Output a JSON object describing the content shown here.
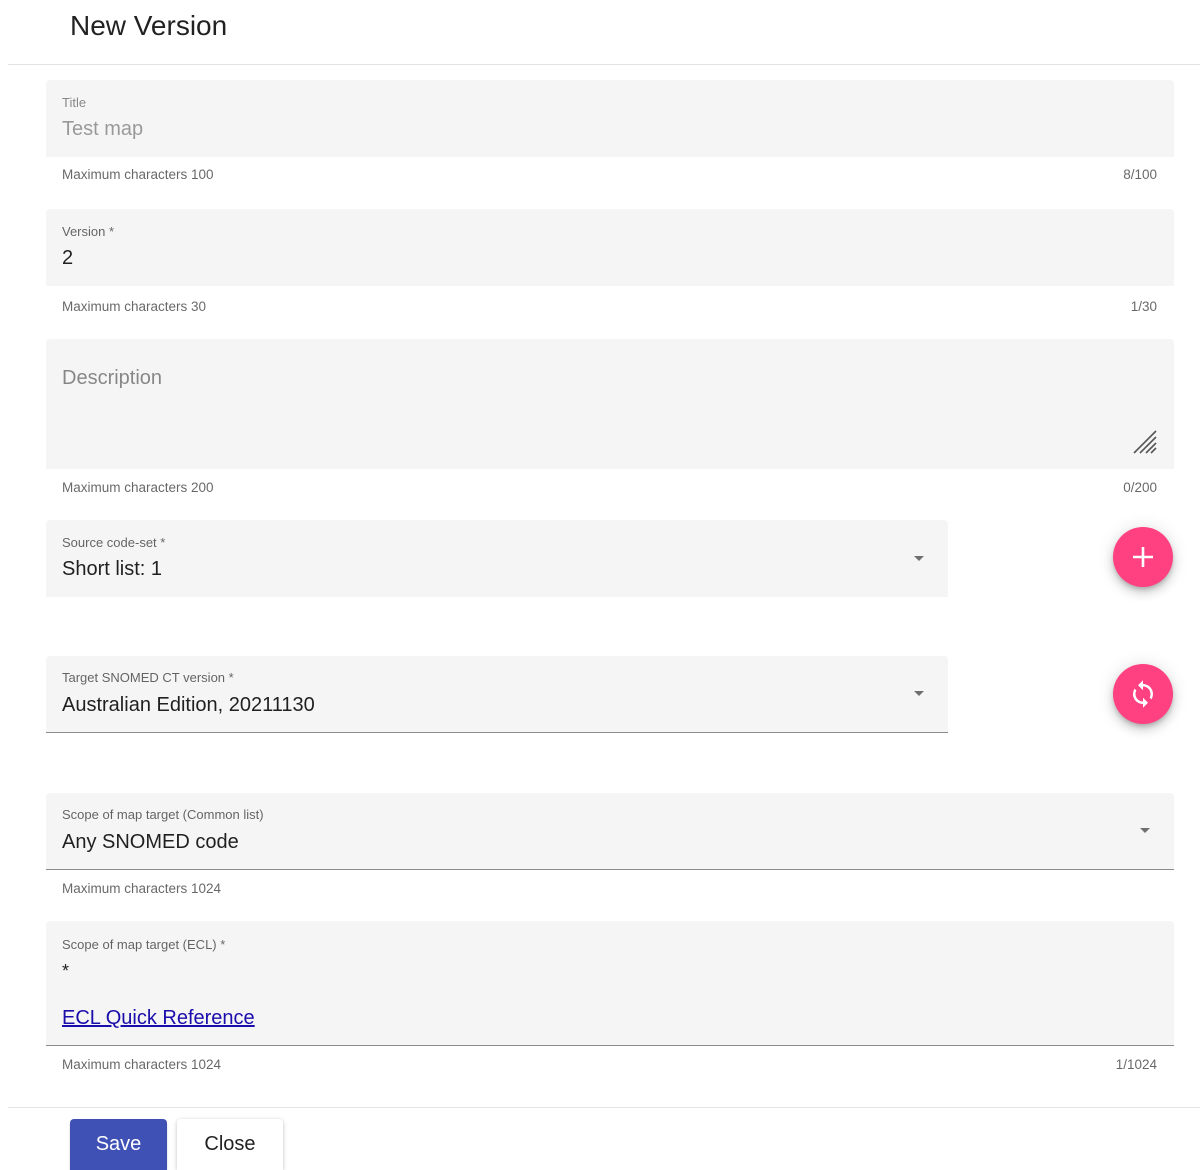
{
  "dialog": {
    "title": "New Version"
  },
  "fields": {
    "title": {
      "label": "Title",
      "value": "Test map",
      "hint": "Maximum characters 100",
      "counter": "8/100"
    },
    "version": {
      "label": "Version *",
      "value": "2",
      "hint": "Maximum characters 30",
      "counter": "1/30"
    },
    "description": {
      "placeholder": "Description",
      "hint": "Maximum characters 200",
      "counter": "0/200"
    },
    "source_code_set": {
      "label": "Source code-set *",
      "value": "Short list: 1",
      "icon": "chevron-down-icon"
    },
    "target_snomed_version": {
      "label": "Target SNOMED CT version *",
      "value": "Australian Edition, 20211130",
      "icon": "chevron-down-icon"
    },
    "scope_common_list": {
      "label": "Scope of map target (Common list)",
      "value": "Any SNOMED code",
      "hint": "Maximum characters 1024",
      "icon": "chevron-down-icon"
    },
    "scope_ecl": {
      "label": "Scope of map target (ECL) *",
      "value": "*",
      "link": "ECL Quick Reference",
      "hint": "Maximum characters 1024",
      "counter": "1/1024"
    }
  },
  "fabs": {
    "add": {
      "icon": "plus-icon",
      "color": "#ff4081"
    },
    "refresh": {
      "icon": "sync-icon",
      "color": "#ff4081"
    }
  },
  "actions": {
    "save_label": "Save",
    "close_label": "Close",
    "primary_color": "#3f51b5"
  }
}
